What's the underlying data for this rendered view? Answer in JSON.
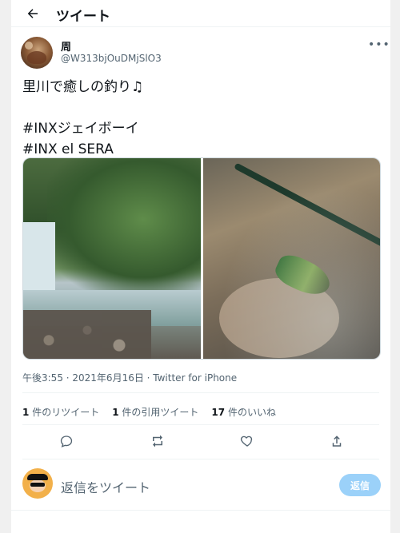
{
  "header": {
    "title": "ツイート"
  },
  "tweet": {
    "author_name": "周",
    "handle": "@W313bjOuDMjSlO3",
    "text": "里川で癒しの釣り♫\n\n#INXジェイボーイ\n#INX el SERA",
    "timestamp": "午後3:55 · 2021年6月16日 · Twitter for iPhone"
  },
  "stats": {
    "retweets_count": "1",
    "retweets_label": "件のリツイート",
    "quotes_count": "1",
    "quotes_label": "件の引用ツイート",
    "likes_count": "17",
    "likes_label": "件のいいね"
  },
  "reply": {
    "placeholder": "返信をツイート",
    "button_label": "返信"
  },
  "icons": {
    "back": "arrow-left-icon",
    "more": "more-dots-icon",
    "reply": "reply-icon",
    "retweet": "retweet-icon",
    "like": "heart-icon",
    "share": "share-icon"
  },
  "colors": {
    "accent": "#1d9bf0",
    "reply_button_bg": "#9bd1f9",
    "text_primary": "#0f1419",
    "text_secondary": "#536471"
  }
}
